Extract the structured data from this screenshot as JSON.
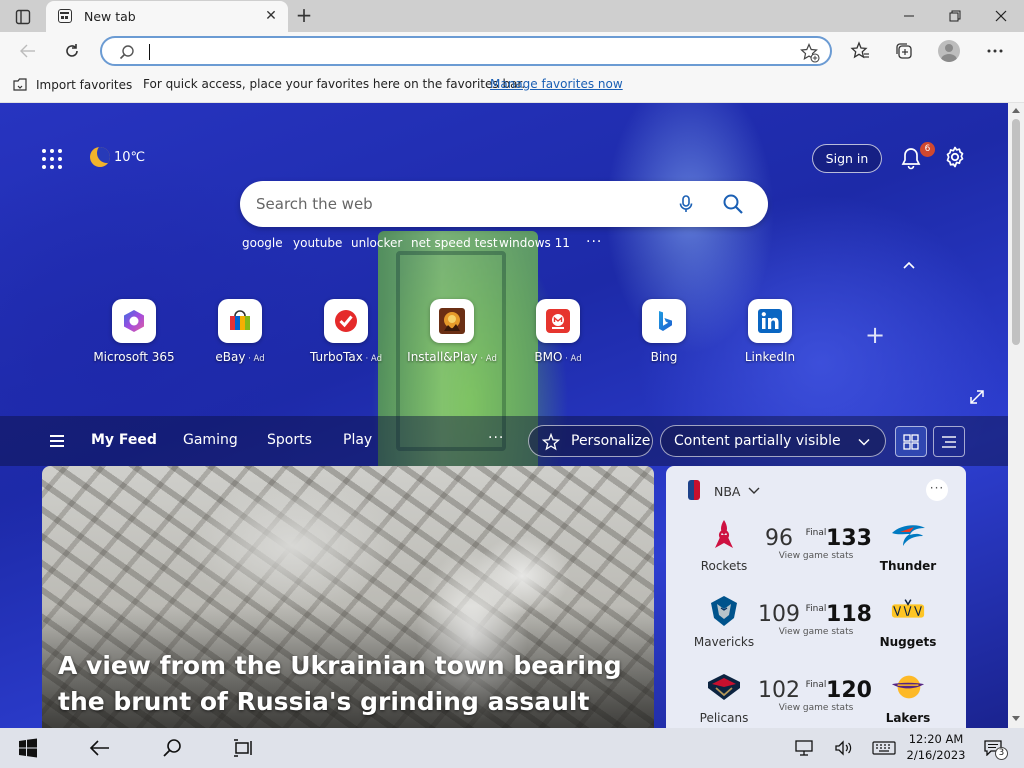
{
  "browser": {
    "tab_title": "New tab",
    "address_value": "",
    "favorites_bar": {
      "import_label": "Import favorites",
      "message": "For quick access, place your favorites here on the favorites bar.",
      "manage_link": "Manage favorites now"
    }
  },
  "ntp": {
    "weather": {
      "temp": "10℃",
      "icon": "moon-icon"
    },
    "sign_in_label": "Sign in",
    "notification_count": "6",
    "search": {
      "placeholder": "Search the web",
      "trending": [
        "google",
        "youtube",
        "unlocker",
        "net speed test",
        "windows 11"
      ]
    },
    "quick_links": [
      {
        "name": "Microsoft 365",
        "ad": "",
        "icon": "microsoft-365-icon"
      },
      {
        "name": "eBay",
        "ad": " · Ad",
        "icon": "ebay-icon"
      },
      {
        "name": "TurboTax",
        "ad": " · Ad",
        "icon": "turbotax-icon"
      },
      {
        "name": "Install&Play",
        "ad": " · Ad",
        "icon": "install-play-icon"
      },
      {
        "name": "BMO",
        "ad": " · Ad",
        "icon": "bmo-icon"
      },
      {
        "name": "Bing",
        "ad": "",
        "icon": "bing-icon"
      },
      {
        "name": "LinkedIn",
        "ad": "",
        "icon": "linkedin-icon"
      }
    ],
    "feed_nav": {
      "tabs": [
        "My Feed",
        "Gaming",
        "Sports",
        "Play"
      ],
      "active_tab": "My Feed",
      "personalize_label": "Personalize",
      "content_visibility": "Content partially visible"
    },
    "hero": {
      "title": "A view from the Ukrainian town bearing the brunt of Russia's grinding assault"
    },
    "nba": {
      "title": "NBA",
      "final_label": "Final",
      "stats_label": "View game stats",
      "games": [
        {
          "home": {
            "name": "Rockets",
            "score": "96",
            "badge": "#ce1141"
          },
          "away": {
            "name": "Thunder",
            "score": "133",
            "badge": "#007ac1"
          },
          "winner": "away"
        },
        {
          "home": {
            "name": "Mavericks",
            "score": "109",
            "badge": "#00538c"
          },
          "away": {
            "name": "Nuggets",
            "score": "118",
            "badge": "#fec524"
          },
          "winner": "away"
        },
        {
          "home": {
            "name": "Pelicans",
            "score": "102",
            "badge": "#0c2340"
          },
          "away": {
            "name": "Lakers",
            "score": "120",
            "badge": "#552583"
          },
          "winner": "away"
        }
      ]
    }
  },
  "taskbar": {
    "time": "12:20 AM",
    "date": "2/16/2023",
    "notification_count": "3"
  }
}
